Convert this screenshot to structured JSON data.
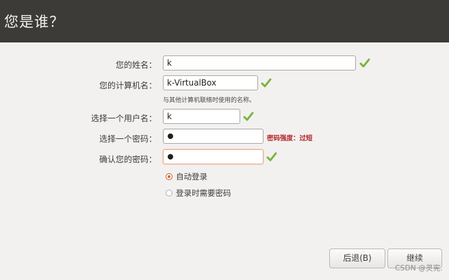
{
  "header": {
    "title": "您是谁？"
  },
  "form": {
    "name": {
      "label": "您的姓名：",
      "value": "k"
    },
    "computer_name": {
      "label": "您的计算机名：",
      "value": "k-VirtualBox",
      "hint": "与其他计算机联络时使用的名称。"
    },
    "username": {
      "label": "选择一个用户名：",
      "value": "k"
    },
    "password": {
      "label": "选择一个密码：",
      "strength": "密码强度：过短"
    },
    "confirm_password": {
      "label": "确认您的密码："
    },
    "login_options": {
      "auto_login": "自动登录",
      "require_password": "登录时需要密码",
      "selected": "auto_login"
    }
  },
  "buttons": {
    "back": "后退(B)",
    "continue": "继续"
  },
  "watermark": "CSDN @灵宪.",
  "colors": {
    "header_bg": "#3c3b37",
    "accent": "#e0602d",
    "check_green": "#7ab43c",
    "strength_red": "#b2282c"
  },
  "icons": {
    "valid": "check-icon"
  }
}
